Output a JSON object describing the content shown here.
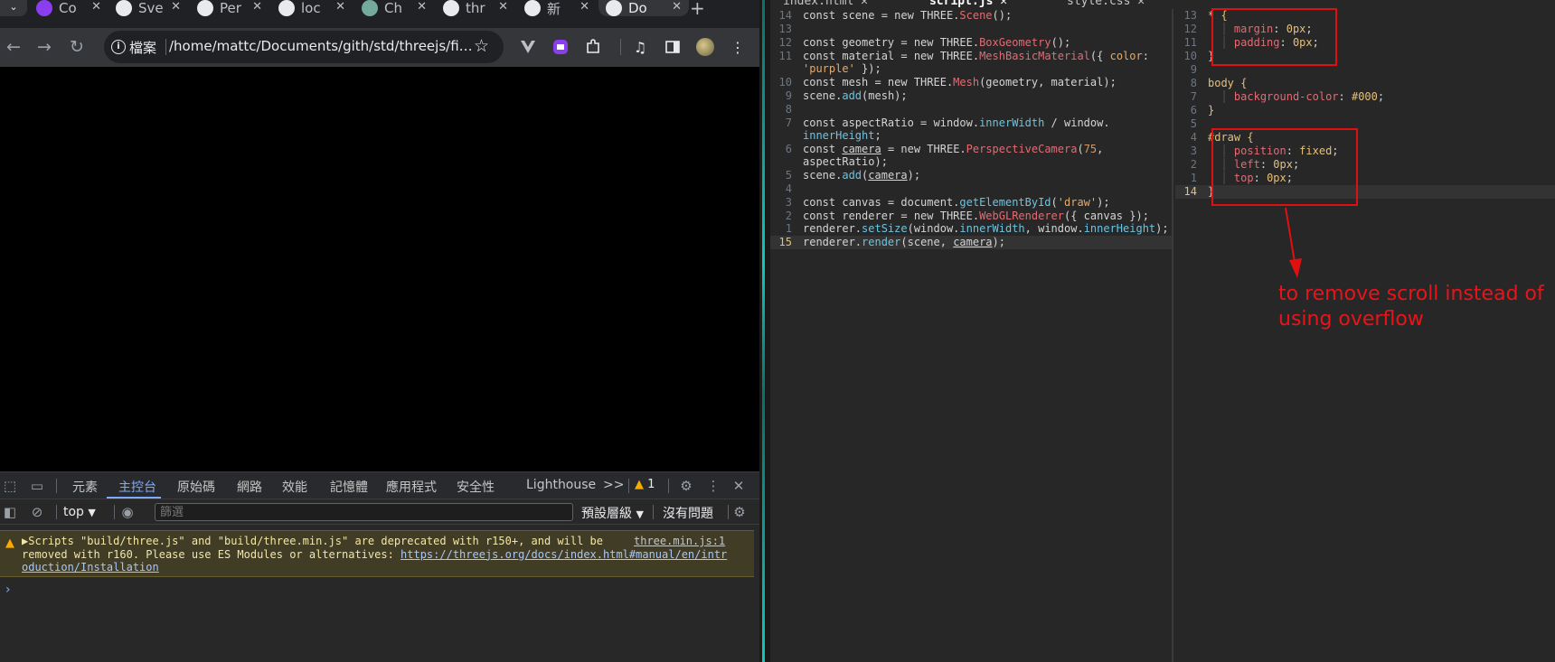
{
  "browser": {
    "tab_menu": "⌄",
    "tabs": [
      {
        "label": "Co",
        "icon": "purple-app-icon",
        "color": "#8b3df0"
      },
      {
        "label": "Sve",
        "icon": "svelte-icon",
        "color": "#e8eaed"
      },
      {
        "label": "Per",
        "icon": "perplexity-icon",
        "color": "#e8eaed"
      },
      {
        "label": "loc",
        "icon": "globe-icon",
        "color": "#e8eaed"
      },
      {
        "label": "Ch",
        "icon": "chatgpt-icon",
        "color": "#74aa9c"
      },
      {
        "label": "thr",
        "icon": "github-icon",
        "color": "#e8eaed"
      },
      {
        "label": "新",
        "icon": "chrome-icon",
        "color": "#e8eaed"
      },
      {
        "label": "Do",
        "icon": "globe-icon",
        "color": "#e8eaed",
        "active": true
      }
    ],
    "new_tab": "+",
    "address": {
      "chip": "檔案",
      "url": "/home/mattc/Documents/gith/std/threejs/first-sc..."
    },
    "devtools": {
      "tabs": [
        "元素",
        "主控台",
        "原始碼",
        "網路",
        "效能",
        "記憶體",
        "應用程式",
        "安全性",
        "Lighthouse"
      ],
      "active_tab": "主控台",
      "more": ">>",
      "warning_count": "1",
      "context": "top",
      "filter_placeholder": "篩選",
      "levels": "預設層級",
      "issues": "沒有問題",
      "console_message": {
        "line1": "Scripts \"build/three.js\" and \"build/three.min.js\" are deprecated with r150+, and will be",
        "line2": "removed with r160. Please use ES Modules or alternatives: ",
        "link": "https://threejs.org/docs/index.html#manual/en/intr",
        "link2": "oduction/Installation",
        "source": "three.min.js:1"
      },
      "prompt": "›"
    }
  },
  "editor": {
    "tabs": [
      {
        "label": "index.html",
        "close": "✕"
      },
      {
        "label": "script.js",
        "close": "✕",
        "active": true
      },
      {
        "label": "style.css",
        "close": "✕"
      }
    ],
    "script_lines": [
      {
        "n": "14",
        "code": "const scene = new THREE.Scene();"
      },
      {
        "n": "13",
        "code": ""
      },
      {
        "n": "12",
        "code": "const geometry = new THREE.BoxGeometry();"
      },
      {
        "n": "11",
        "code": "const material = new THREE.MeshBasicMaterial({ color:"
      },
      {
        "n": "",
        "code": "'purple' });"
      },
      {
        "n": "10",
        "code": "const mesh = new THREE.Mesh(geometry, material);"
      },
      {
        "n": "9",
        "code": "scene.add(mesh);"
      },
      {
        "n": "8",
        "code": ""
      },
      {
        "n": "7",
        "code": "const aspectRatio = window.innerWidth / window."
      },
      {
        "n": "",
        "code": "innerHeight;"
      },
      {
        "n": "6",
        "code": "const camera = new THREE.PerspectiveCamera(75,"
      },
      {
        "n": "",
        "code": "aspectRatio);"
      },
      {
        "n": "5",
        "code": "scene.add(camera);"
      },
      {
        "n": "4",
        "code": ""
      },
      {
        "n": "3",
        "code": "const canvas = document.getElementById('draw');"
      },
      {
        "n": "2",
        "code": "const renderer = new THREE.WebGLRenderer({ canvas });"
      },
      {
        "n": "1",
        "code": "renderer.setSize(window.innerWidth, window.innerHeight);"
      },
      {
        "n": "15",
        "code": "renderer.render(scene, camera);",
        "current": true
      }
    ],
    "css_lines": [
      {
        "n": "13",
        "code": "* {"
      },
      {
        "n": "12",
        "code": "  margin: 0px;"
      },
      {
        "n": "11",
        "code": "  padding: 0px;"
      },
      {
        "n": "10",
        "code": "}"
      },
      {
        "n": "9",
        "code": ""
      },
      {
        "n": "8",
        "code": "body {"
      },
      {
        "n": "7",
        "code": "  background-color: #000;"
      },
      {
        "n": "6",
        "code": "}"
      },
      {
        "n": "5",
        "code": ""
      },
      {
        "n": "4",
        "code": "#draw {"
      },
      {
        "n": "3",
        "code": "  position: fixed;"
      },
      {
        "n": "2",
        "code": "  left: 0px;"
      },
      {
        "n": "1",
        "code": "  top: 0px;"
      },
      {
        "n": "14",
        "code": "}",
        "current": true
      }
    ],
    "annotation": "to remove scroll instead of using overflow",
    "annotation_color": "#e8141a"
  }
}
